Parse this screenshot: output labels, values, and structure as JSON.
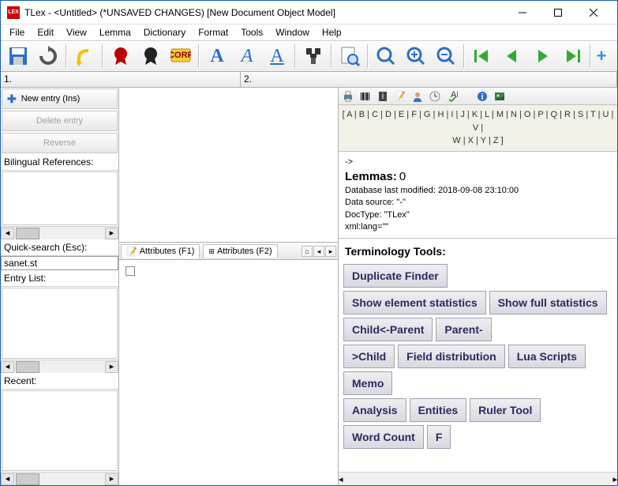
{
  "title": "TLex - <Untitled> (*UNSAVED CHANGES) [New Document Object Model]",
  "menu": [
    "File",
    "Edit",
    "View",
    "Lemma",
    "Dictionary",
    "Format",
    "Tools",
    "Window",
    "Help"
  ],
  "header_cells": [
    "1.",
    "2."
  ],
  "left": {
    "new_entry": "New entry (Ins)",
    "delete_entry": "Delete entry",
    "reverse": "Reverse",
    "biling_ref": "Bilingual References:",
    "quick_search_label": "Quick-search (Esc):",
    "quick_search_value": "sanet.st",
    "entry_list": "Entry List:",
    "recent": "Recent:"
  },
  "tabs": {
    "attr1": "Attributes (F1)",
    "attr2": "Attributes (F2)"
  },
  "alpha_row1": "[ A | B | C | D | E | F | G | H | I | J | K | L | M | N | O | P | Q | R | S | T | U | V |",
  "alpha_row2": "W | X | Y | Z ]",
  "info": {
    "arrow": "->",
    "lemmas_label": "Lemmas:",
    "lemmas_count": "0",
    "db_modified": "Database last modified: 2018-09-08 23:10:00",
    "data_source": "Data source: \"-\"",
    "doctype": "DocType: \"TLex\"",
    "xmllang": "xml:lang=\"\""
  },
  "tools": {
    "title": "Terminology Tools:",
    "buttons": [
      "Duplicate Finder",
      "Show element statistics",
      "Show full statistics",
      "Child<-Parent",
      "Parent-",
      ">Child",
      "Field distribution",
      "Lua Scripts",
      "Memo",
      "Analysis",
      "Entities",
      "Ruler Tool",
      "Word Count",
      "F"
    ]
  }
}
